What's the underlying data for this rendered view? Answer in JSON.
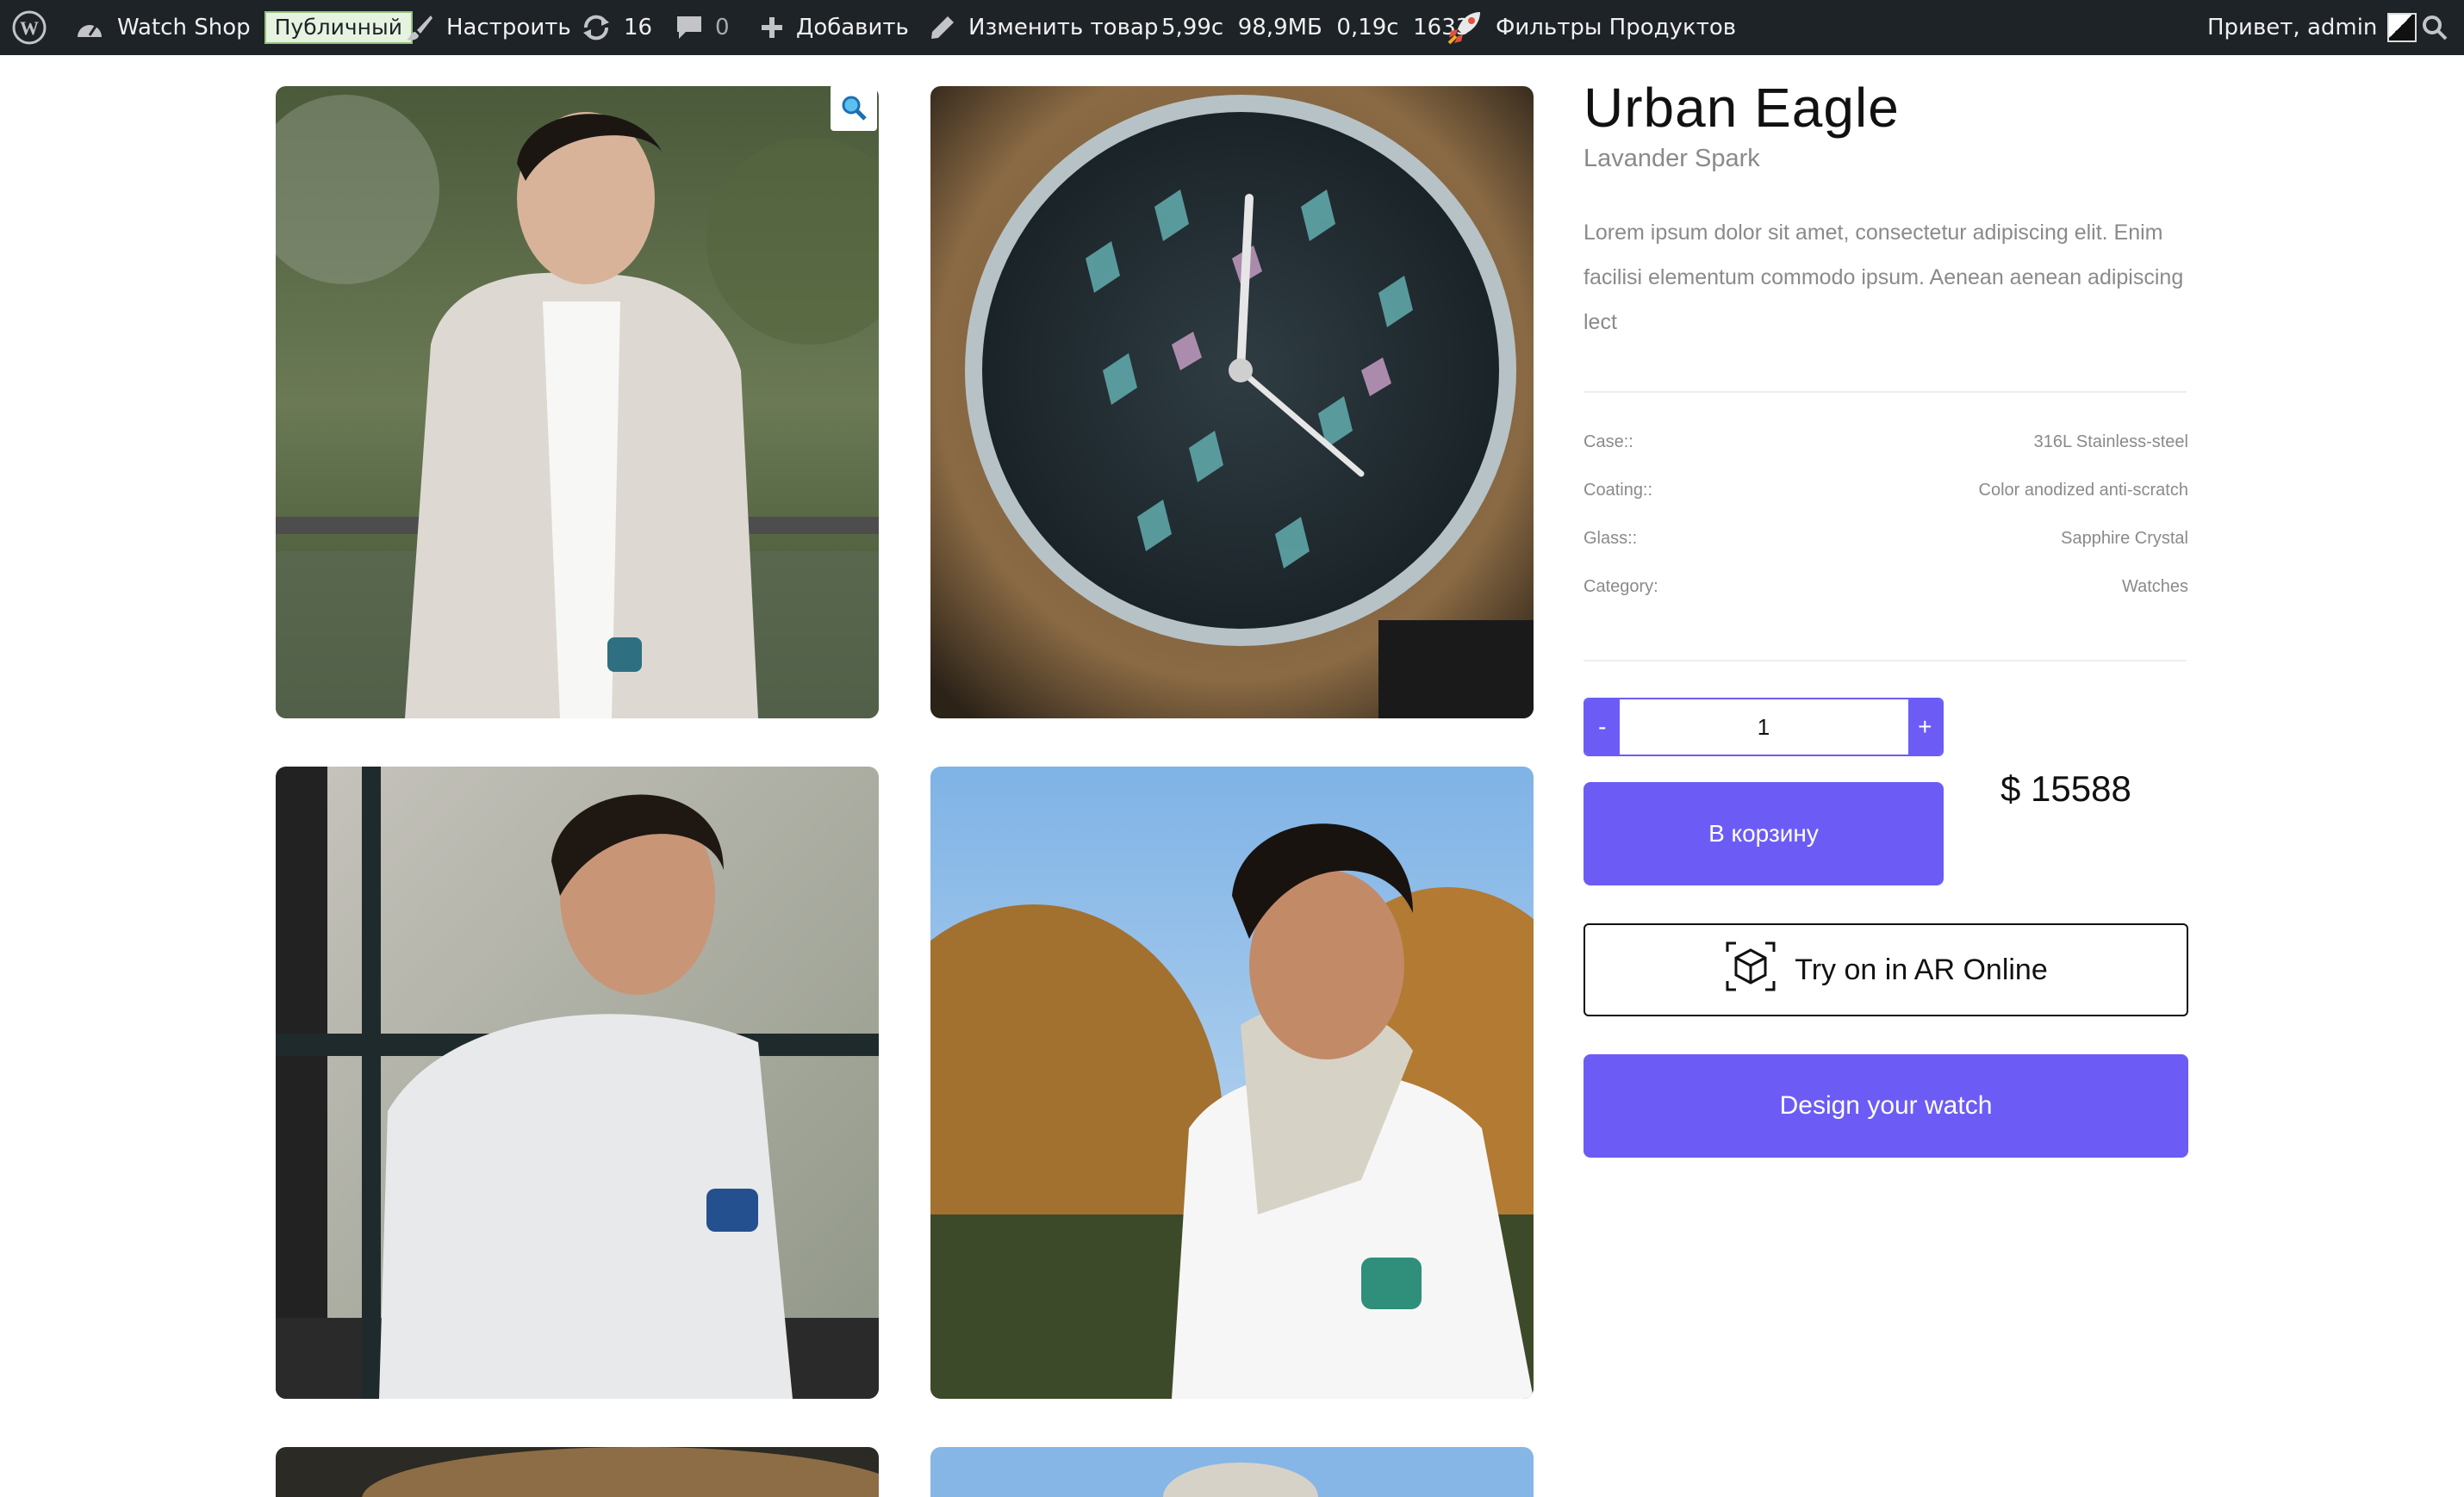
{
  "adminbar": {
    "site_name": "Watch Shop",
    "visibility_badge": "Публичный",
    "customize": "Настроить",
    "updates_count": "16",
    "comments_count": "0",
    "add_new": "Добавить",
    "edit_product": "Изменить товар",
    "perf_stats": "5,99с  98,9МБ  0,19с  1633",
    "product_filters": "Фильтры Продуктов",
    "greeting": "Привет, admin"
  },
  "product": {
    "title": "Urban Eagle",
    "subtitle": "Lavander Spark",
    "description": "Lorem ipsum dolor sit amet, consectetur adipiscing elit. Enim facilisi elementum commodo ipsum. Aenean aenean adipiscing lect",
    "specs": [
      {
        "label": "Case::",
        "value": "316L Stainless-steel"
      },
      {
        "label": "Coating::",
        "value": "Color anodized anti-scratch"
      },
      {
        "label": "Glass::",
        "value": "Sapphire Crystal"
      },
      {
        "label": "Category:",
        "value": "Watches"
      }
    ],
    "quantity": "1",
    "qty_minus": "-",
    "qty_plus": "+",
    "add_to_cart": "В корзину",
    "price": "$ 15588",
    "ar_button": "Try on in AR Online",
    "design_button": "Design your watch"
  },
  "colors": {
    "accent": "#6c5cf5",
    "adminbar_bg": "#1d2327"
  }
}
